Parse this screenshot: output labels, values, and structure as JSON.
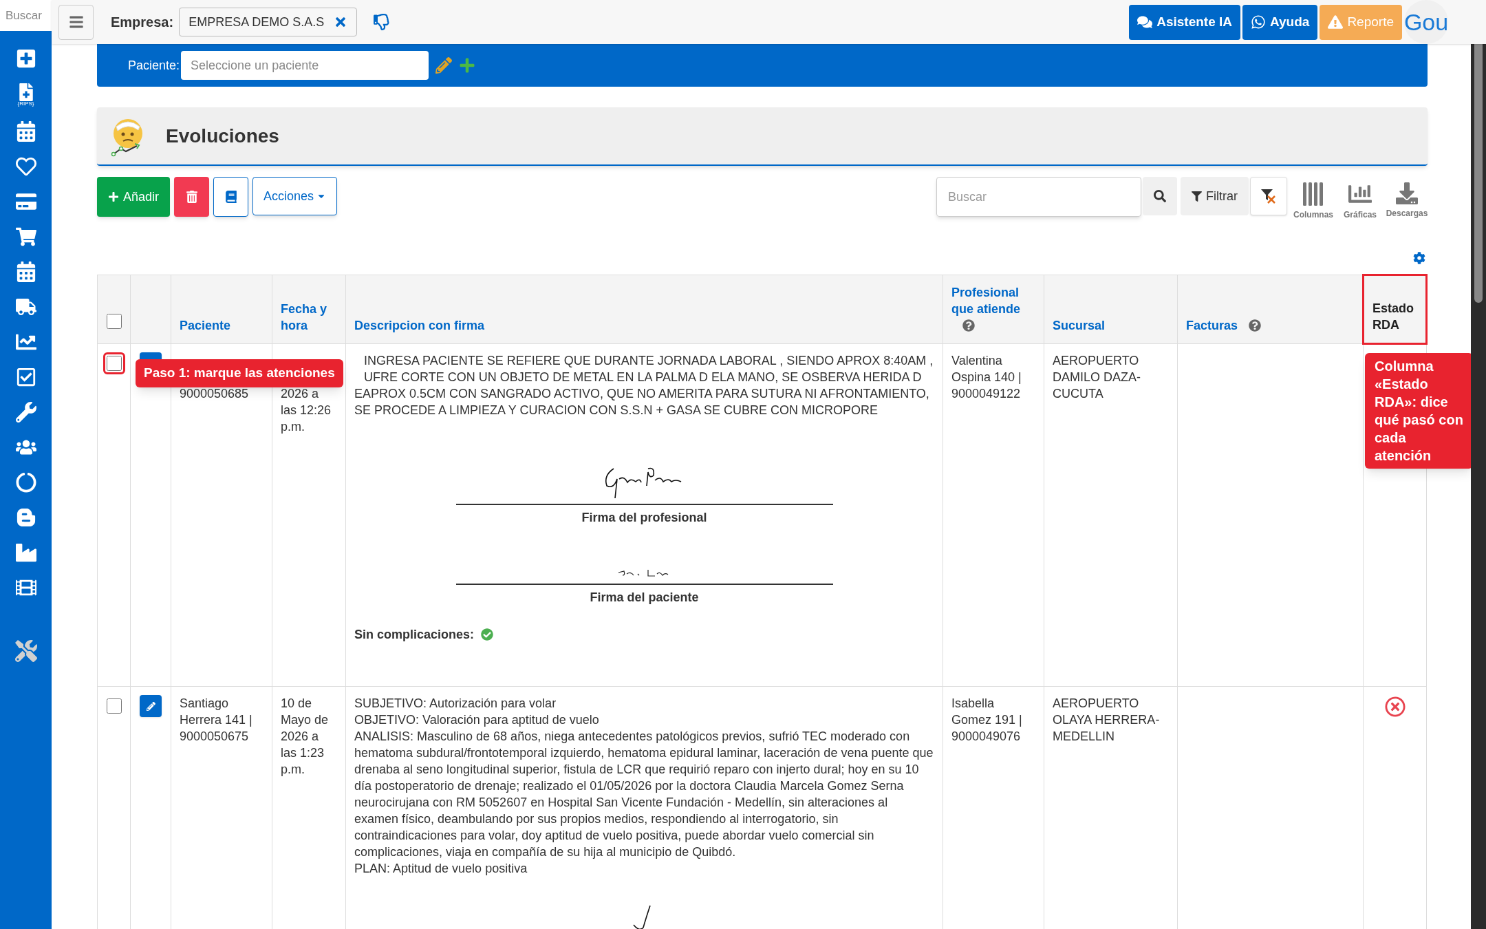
{
  "sidebar": {
    "search_placeholder": "Buscar",
    "rips_label": "{RIPS}"
  },
  "topbar": {
    "empresa_label": "Empresa:",
    "empresa_value": "EMPRESA DEMO S.A.S",
    "buttons": [
      {
        "kind": "chat",
        "label": "Asistente IA"
      },
      {
        "kind": "whatsapp",
        "label": "Ayuda"
      },
      {
        "kind": "warning",
        "label": "Reporte"
      }
    ],
    "avatar": "Gou"
  },
  "patient_bar": {
    "label": "Paciente:",
    "placeholder": "Seleccione un paciente"
  },
  "page_title": "Evoluciones",
  "toolbar": {
    "add": "Añadir",
    "actions": "Acciones",
    "search_placeholder": "Buscar",
    "filter": "Filtrar",
    "tools": [
      {
        "kind": "columns",
        "label": "Columnas"
      },
      {
        "kind": "charts",
        "label": "Gráficas"
      },
      {
        "kind": "downloads",
        "label": "Descargas"
      }
    ]
  },
  "table": {
    "select_all": {
      "checked": false
    },
    "columns": [
      {
        "label": "Paciente",
        "help": false
      },
      {
        "label": "Fecha y hora",
        "help": false
      },
      {
        "label": "Descripcion con firma",
        "help": false
      },
      {
        "label": "Profesional que atiende",
        "help": true
      },
      {
        "label": "Sucursal",
        "help": false
      },
      {
        "label": "Facturas",
        "help": true
      },
      {
        "label": "Estado RDA",
        "help": false,
        "highlighted": true
      }
    ],
    "rows": [
      {
        "checked": false,
        "highlighted": true,
        "patient": "9000050685",
        "date": "2026 a las 12:26 p.m.",
        "description": [
          "INGRESA PACIENTE SE REFIERE QUE DURANTE JORNADA LABORAL , SIENDO APROX 8:40AM ,",
          "UFRE CORTE CON UN OBJETO DE METAL EN LA PALMA D ELA MANO, SE OSBERVA HERIDA D",
          "EAPROX 0.5CM CON SANGRADO ACTIVO, QUE NO AMERITA PARA SUTURA NI AFRONTAMIENTO,",
          "SE PROCEDE A LIMPIEZA Y CURACION CON S.S.N + GASA SE CUBRE CON MICROPORE"
        ],
        "signatures": [
          "Firma del profesional",
          "Firma del paciente"
        ],
        "complications": {
          "label": "Sin complicaciones:",
          "ok": true
        },
        "professional": "Valentina Ospina 140 | 9000049122",
        "branch": "AEROPUERTO DAMILO DAZA-CUCUTA",
        "rda_rejected": false
      },
      {
        "checked": false,
        "highlighted": false,
        "patient": "Santiago Herrera 141 | 9000050675",
        "date": "10 de Mayo de 2026 a las 1:23 p.m.",
        "description": [
          "SUBJETIVO: Autorización para volar",
          "OBJETIVO: Valoración para aptitud de vuelo",
          "ANALISIS: Masculino de 68 años, niega antecedentes patológicos previos, sufrió TEC moderado con hematoma subdural/frontotemporal izquierdo, hematoma epidural laminar, laceración de vena puente que drenaba al seno longitudinal superior, fistula de LCR que requirió reparo con injerto dural; hoy en su 10 día postoperatorio de drenaje; realizado el 01/05/2026 por la doctora Claudia Marcela Gomez Serna neurocirujana con RM 5052607 en Hospital San Vicente Fundación - Medellín, sin alteraciones al examen físico, deambulando por sus propios medios, respondiendo al interrogatorio, sin contraindicaciones para volar, doy aptitud de vuelo positiva, puede abordar vuelo comercial sin complicaciones, viaja en compañía de su hija al municipio de Quibdó.",
          "PLAN: Aptitud de vuelo positiva"
        ],
        "signatures": [],
        "professional": "Isabella Gomez 191 | 9000049076",
        "branch": "AEROPUERTO OLAYA HERRERA-MEDELLIN",
        "rda_rejected": true
      }
    ]
  },
  "callouts": [
    {
      "kind": "row",
      "text": "Paso 1: marque las atenciones"
    },
    {
      "kind": "column",
      "text": "Columna «Estado RDA»: dice qué pasó con cada atención"
    }
  ]
}
